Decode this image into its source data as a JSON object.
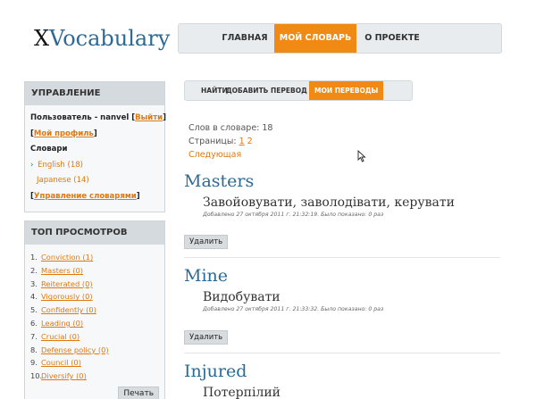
{
  "header": {
    "logo_x": "X",
    "logo_rest": "Vocabulary",
    "nav": [
      {
        "label": "ГЛАВНАЯ"
      },
      {
        "label": "МОЙ СЛОВАРЬ"
      },
      {
        "label": "О ПРОЕКТЕ"
      }
    ]
  },
  "sidebar": {
    "management": {
      "title": "УПРАВЛЕНИЕ",
      "user_text": "Пользователь - nanvel ",
      "logout": "Выйти",
      "profile": "Мой профиль",
      "dicts_label": "Словари",
      "dicts": [
        {
          "label": "English (18)"
        },
        {
          "label": "Japanese (14)"
        }
      ],
      "manage": "Управление словарями"
    },
    "top": {
      "title": "ТОП ПРОСМОТРОВ",
      "items": [
        {
          "n": "1.",
          "label": "Conviction (1)"
        },
        {
          "n": "2.",
          "label": "Masters (0)"
        },
        {
          "n": "3.",
          "label": "Reiterated (0)"
        },
        {
          "n": "4.",
          "label": "Vigorously (0)"
        },
        {
          "n": "5.",
          "label": "Confidently (0)"
        },
        {
          "n": "6.",
          "label": "Leading (0)"
        },
        {
          "n": "7.",
          "label": "Crucial (0)"
        },
        {
          "n": "8.",
          "label": "Defense policy (0)"
        },
        {
          "n": "9.",
          "label": "Council (0)"
        },
        {
          "n": "10.",
          "label": "Diversify (0)"
        }
      ],
      "print": "Печать"
    }
  },
  "subnav": {
    "find": "НАЙТИ",
    "add": "ДОБАВИТЬ ПЕРЕВОД",
    "mine": "МОИ ПЕРЕВОДЫ"
  },
  "stats": {
    "count": "Слов в словаре: 18",
    "pages_label": "Страницы: ",
    "page1": "1",
    "page2": "2",
    "next": "Следующая"
  },
  "entries": [
    {
      "word": "Masters",
      "translation": "Завойовувати, заволодівати, керувати",
      "meta": "Добавлено 27 октября 2011 г. 21:32:19. Было показано: 0 раз",
      "delete": "Удалить"
    },
    {
      "word": "Mine",
      "translation": "Видобувати",
      "meta": "Добавлено 27 октября 2011 г. 21:33:32. Было показано: 0 раз",
      "delete": "Удалить"
    },
    {
      "word": "Injured",
      "translation": "Потерпілий",
      "meta": "",
      "delete": ""
    }
  ],
  "colors": {
    "accent": "#f08a14",
    "link": "#2d6a93"
  }
}
